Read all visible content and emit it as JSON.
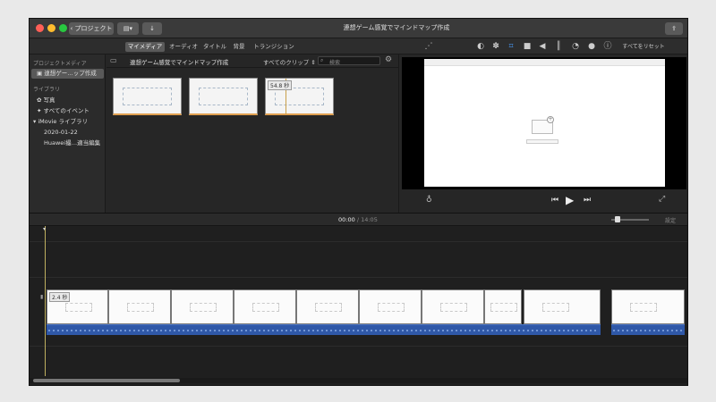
{
  "window": {
    "title": "連想ゲーム感覚でマインドマップ作成"
  },
  "titlebar": {
    "back_label": "プロジェクト",
    "colors": {
      "close": "#ff5f57",
      "minimize": "#febc2e",
      "zoom": "#28c840"
    }
  },
  "toolbar": {
    "tabs": [
      {
        "label": "マイメディア",
        "active": true
      },
      {
        "label": "オーディオ",
        "active": false
      },
      {
        "label": "タイトル",
        "active": false
      },
      {
        "label": "背景",
        "active": false
      },
      {
        "label": "トランジション",
        "active": false
      }
    ],
    "reset_label": "すべてをリセット",
    "tool_icons": [
      "magic-wand-icon",
      "color-balance-icon",
      "color-palette-icon",
      "crop-icon",
      "camera-icon",
      "volume-icon",
      "equalizer-icon",
      "speed-icon",
      "filter-icon",
      "info-icon"
    ]
  },
  "sidebar": {
    "project_media_heading": "プロジェクトメディア",
    "project_item": "連想ゲー…ップ作成",
    "library_heading": "ライブラリ",
    "items": [
      {
        "label": "写真"
      },
      {
        "label": "すべてのイベント"
      },
      {
        "label": "iMovie ライブラリ"
      },
      {
        "label": "2020-01-22"
      },
      {
        "label": "Huawei撮…適当編集"
      }
    ]
  },
  "browser": {
    "title": "連想ゲーム感覚でマインドマップ作成",
    "filter": "すべてのクリップ",
    "search_placeholder": "検索",
    "thumb_duration": "54.8 秒"
  },
  "timeline": {
    "current_time": "00:00",
    "separator": "/",
    "total_time": "14:05",
    "settings_label": "設定",
    "first_clip_duration": "2.4 秒"
  },
  "accent_colors": {
    "audio": "#2f58a8",
    "selection": "#595959",
    "clip_marker": "#e0a050"
  }
}
